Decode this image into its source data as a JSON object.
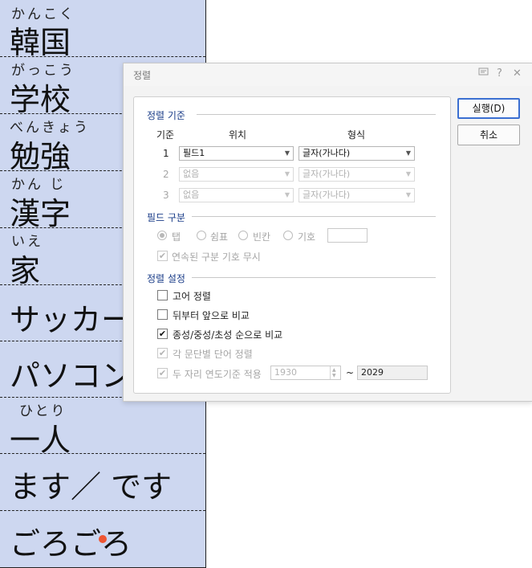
{
  "document": {
    "cells": [
      {
        "ruby": "かんこく",
        "text": "韓国"
      },
      {
        "ruby": "がっこう",
        "text": "学校"
      },
      {
        "ruby": "べんきょう",
        "text": "勉強"
      },
      {
        "ruby": "かん じ",
        "text": "漢字"
      },
      {
        "ruby": "いえ",
        "text": "家"
      },
      {
        "ruby": "",
        "text": "サッカー"
      },
      {
        "ruby": "",
        "text": "パソコン"
      },
      {
        "ruby": "ひとり",
        "text": "一人"
      },
      {
        "ruby": "",
        "text": "ます／ です"
      },
      {
        "ruby": "",
        "text": "ごろごろ"
      }
    ]
  },
  "dialog": {
    "title": "정렬",
    "titlebar_icons": [
      "comment-icon",
      "help-icon",
      "close-icon"
    ],
    "buttons": {
      "run": "실행(D)",
      "cancel": "취소"
    },
    "sort_criteria": {
      "heading": "정렬 기준",
      "col_key": "기준",
      "col_position": "위치",
      "col_format": "형식",
      "rows": [
        {
          "num": "1",
          "position": "필드1",
          "format": "글자(가나다)",
          "enabled": true
        },
        {
          "num": "2",
          "position": "없음",
          "format": "글자(가나다)",
          "enabled": false
        },
        {
          "num": "3",
          "position": "없음",
          "format": "글자(가나다)",
          "enabled": false
        }
      ]
    },
    "field_separator": {
      "heading": "필드 구분",
      "options": [
        "탭",
        "쉼표",
        "빈칸",
        "기호"
      ],
      "selected": "탭",
      "symbol_value": "",
      "ignore_consecutive": "연속된 구분 기호 무시"
    },
    "sort_settings": {
      "heading": "정렬 설정",
      "options": [
        {
          "label": "고어 정렬",
          "checked": false,
          "enabled": true
        },
        {
          "label": "뒤부터 앞으로 비교",
          "checked": false,
          "enabled": true
        },
        {
          "label": "종성/중성/초성 순으로 비교",
          "checked": true,
          "enabled": true
        },
        {
          "label": "각 문단별 단어 정렬",
          "checked": true,
          "enabled": false
        },
        {
          "label": "두 자리 연도기준 적용",
          "checked": true,
          "enabled": false
        }
      ],
      "year_from": "1930",
      "year_sep": "~",
      "year_to": "2029"
    }
  },
  "colors": {
    "document_bg": "#cdd7f0",
    "accent_blue": "#3b6fd1",
    "section_heading": "#1a3c88",
    "caret_dot": "#ee5533"
  }
}
